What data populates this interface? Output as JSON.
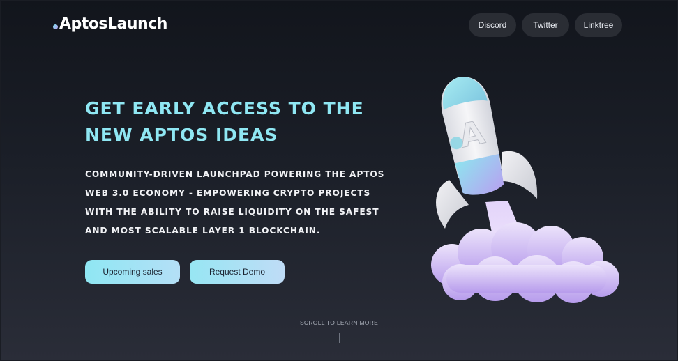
{
  "header": {
    "logo": "AptosLaunch",
    "nav": [
      {
        "label": "Discord"
      },
      {
        "label": "Twitter"
      },
      {
        "label": "Linktree"
      }
    ]
  },
  "hero": {
    "headline_line1": "GET EARLY ACCESS TO THE",
    "headline_line2": "NEW APTOS IDEAS",
    "subhead_lines": [
      "COMMUNITY-DRIVEN LAUNCHPAD POWERING THE APTOS",
      "WEB 3.0 ECONOMY - EMPOWERING CRYPTO PROJECTS",
      "WITH THE ABILITY TO RAISE LIQUIDITY ON THE SAFEST",
      "AND MOST SCALABLE LAYER 1 BLOCKCHAIN."
    ],
    "buttons": {
      "upcoming_sales": "Upcoming sales",
      "request_demo": "Request Demo"
    },
    "rocket_letter": "A"
  },
  "footer": {
    "scroll_hint": "SCROLL TO LEARN MORE"
  },
  "colors": {
    "accent": "#8fe7f3",
    "background_top": "#12151c",
    "background_bottom": "#2a2d38",
    "nav_button": "#2a2d34",
    "rocket_purple": "#c9b6f2"
  }
}
